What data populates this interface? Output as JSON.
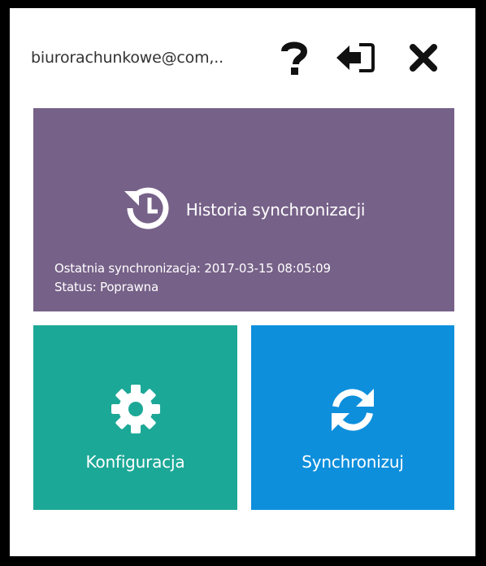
{
  "header": {
    "account": "biurorachunkowe@com,..",
    "help_icon": "question-icon",
    "logout_icon": "sign-out-icon",
    "close_icon": "close-icon"
  },
  "tiles": {
    "history": {
      "label": "Historia synchronizacji",
      "last_sync": "Ostatnia synchronizacja: 2017-03-15 08:05:09",
      "status": "Status: Poprawna",
      "icon": "history-icon",
      "color": "#766188"
    },
    "config": {
      "label": "Konfiguracja",
      "icon": "gear-icon",
      "color": "#1ca897"
    },
    "sync": {
      "label": "Synchronizuj",
      "icon": "refresh-icon",
      "color": "#0d8fdc"
    }
  }
}
